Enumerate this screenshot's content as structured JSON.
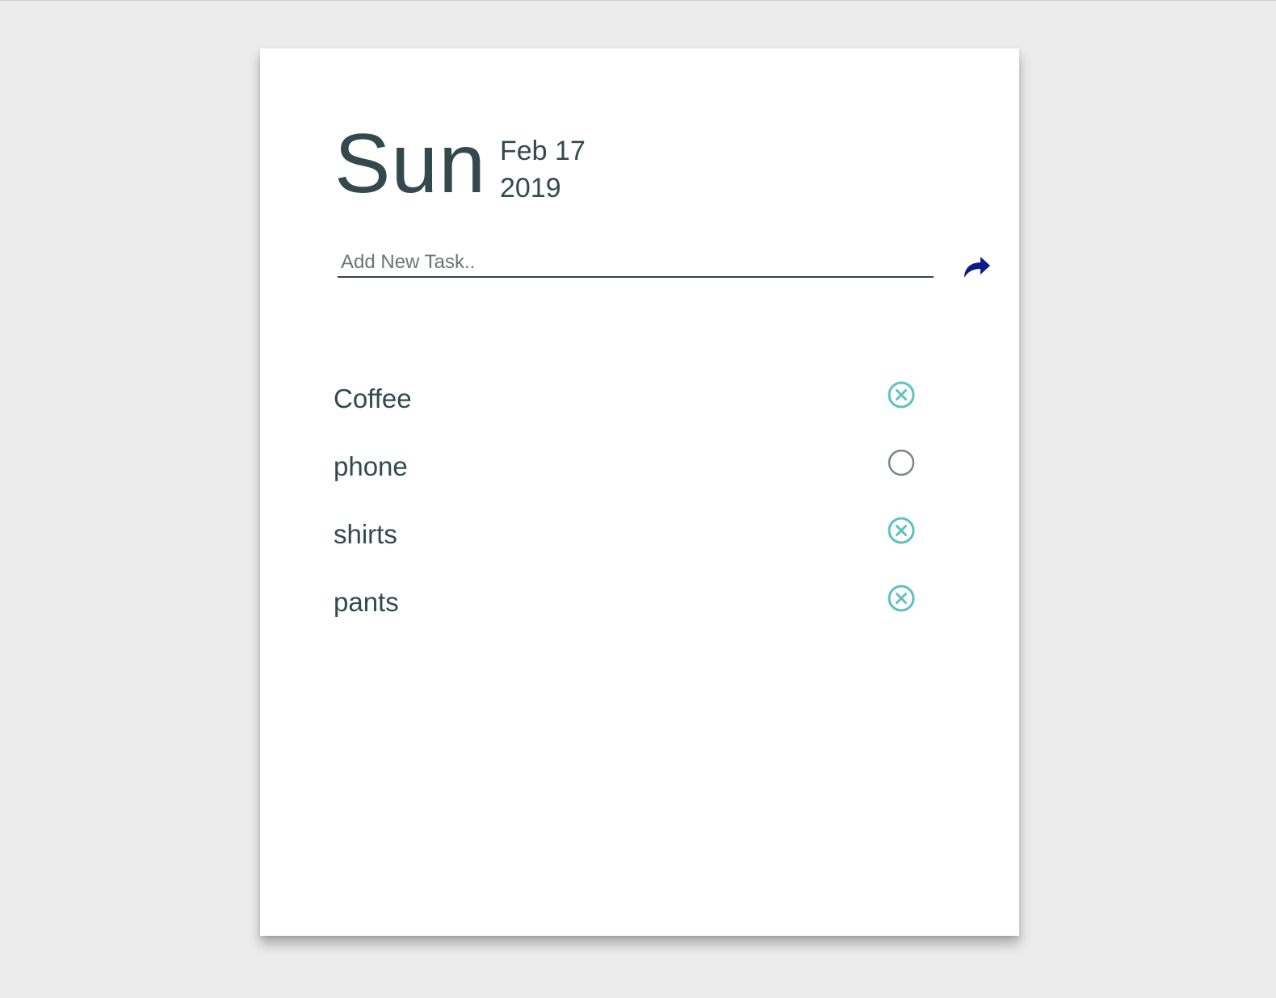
{
  "header": {
    "day": "Sun",
    "month_day": "Feb 17",
    "year": "2019"
  },
  "new_task": {
    "placeholder": "Add New Task..",
    "value": "",
    "submit_icon": "share-arrow-icon",
    "submit_icon_color": "#0c1a8a"
  },
  "tasks": [
    {
      "label": "Coffee",
      "status": "done",
      "icon": "circle-x-icon"
    },
    {
      "label": "phone",
      "status": "pending",
      "icon": "empty-circle-icon"
    },
    {
      "label": "shirts",
      "status": "done",
      "icon": "circle-x-icon"
    },
    {
      "label": "pants",
      "status": "done",
      "icon": "circle-x-icon"
    }
  ],
  "colors": {
    "text": "#34494e",
    "done_icon": "#5ec0c0",
    "pending_icon": "#7d8489",
    "background": "#ececec",
    "card": "#ffffff"
  }
}
